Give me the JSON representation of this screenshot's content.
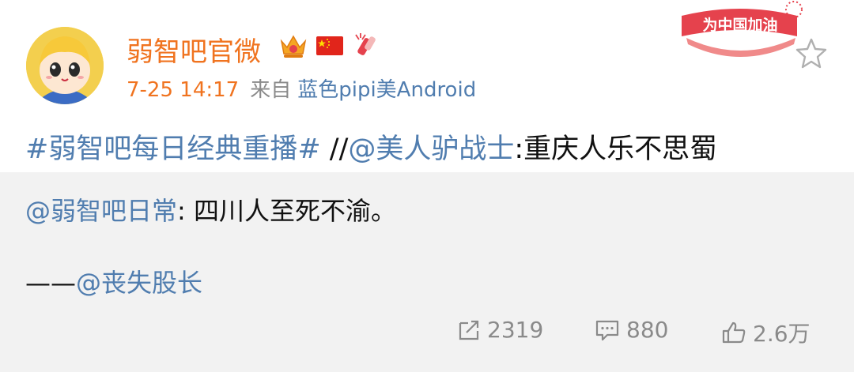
{
  "post": {
    "author": "弱智吧官微",
    "time": "7-25 14:17",
    "source_prefix": "来自",
    "source_device": "蓝色pipi美Android",
    "promo_text": "为中国加油",
    "hashtag": "#弱智吧每日经典重播#",
    "separator": " //",
    "mention": "@美人驴战士",
    "body": ":重庆人乐不思蜀"
  },
  "retweet": {
    "author": "@弱智吧日常",
    "text": ": 四川人至死不渝。",
    "credit_prefix": "——",
    "credit_user": "@丧失股长"
  },
  "actions": {
    "reposts": "2319",
    "comments": "880",
    "likes": "2.6万"
  },
  "colors": {
    "name_orange": "#f0731f",
    "link_blue": "#507daf",
    "meta_gray": "#8a8a8a",
    "retweet_bg": "#f2f2f2"
  },
  "icons": [
    "crown-vip-icon",
    "china-flag-icon",
    "firecracker-icon",
    "star-icon",
    "repost-icon",
    "comment-icon",
    "like-icon"
  ]
}
